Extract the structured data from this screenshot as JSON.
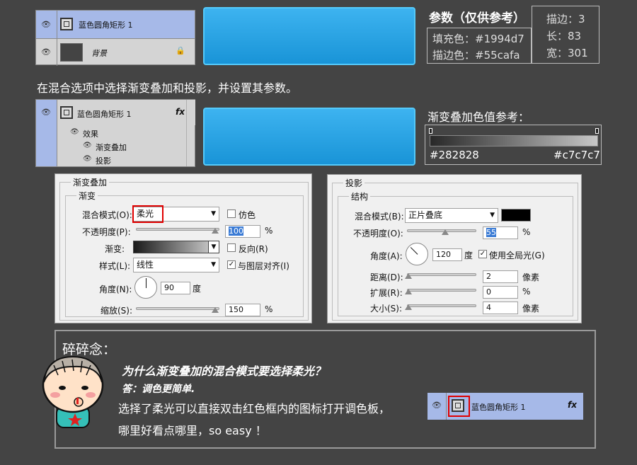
{
  "top_layers": {
    "layer1_name": "蓝色圆角矩形 1",
    "layer2_name": "背景"
  },
  "params": {
    "title": "参数（仅供参考）",
    "fill": "填充色：#1994d7",
    "stroke": "描边色：#55cafa",
    "stroke_w": "描边：3",
    "length": "长：83",
    "width": "宽：301"
  },
  "instruction": "在混合选项中选择渐变叠加和投影，并设置其参数。",
  "mid_layers": {
    "layer_name": "蓝色圆角矩形 1",
    "fx": "fx",
    "effects": "效果",
    "grad_overlay": "渐变叠加",
    "drop_shadow": "投影"
  },
  "gradient_ref": {
    "title": "渐变叠加色值参考：",
    "left_color": "#282828",
    "right_color": "#c7c7c7"
  },
  "grad_dialog": {
    "title": "渐变叠加",
    "group": "渐变",
    "blend_label": "混合模式(O):",
    "blend_value": "柔光",
    "dither": "仿色",
    "opacity_label": "不透明度(P):",
    "opacity_value": "100",
    "pct": "%",
    "gradient_label": "渐变:",
    "reverse": "反向(R)",
    "style_label": "样式(L):",
    "style_value": "线性",
    "align": "与图层对齐(I)",
    "angle_label": "角度(N):",
    "angle_value": "90",
    "deg": "度",
    "scale_label": "缩放(S):",
    "scale_value": "150"
  },
  "shadow_dialog": {
    "title": "投影",
    "group": "结构",
    "blend_label": "混合模式(B):",
    "blend_value": "正片叠底",
    "opacity_label": "不透明度(O):",
    "opacity_value": "55",
    "pct": "%",
    "angle_label": "角度(A):",
    "angle_value": "120",
    "deg": "度",
    "global_light": "使用全局光(G)",
    "distance_label": "距离(D):",
    "distance_value": "2",
    "px": "像素",
    "spread_label": "扩展(R):",
    "spread_value": "0",
    "size_label": "大小(S):",
    "size_value": "4"
  },
  "note": {
    "heading": "碎碎念：",
    "question": "为什么渐变叠加的混合模式要选择柔光？",
    "answer": "答：调色更简单.",
    "line1": "选择了柔光可以直接双击红色框内的图标打开调色板，",
    "line2": "哪里好看点哪里，so easy ！",
    "layer_name": "蓝色圆角矩形 1",
    "fx": "fx"
  },
  "colors": {
    "fill": "#1994d7",
    "stroke": "#55cafa",
    "selection": "#a6b9e8",
    "highlight_red": "#e00000"
  }
}
